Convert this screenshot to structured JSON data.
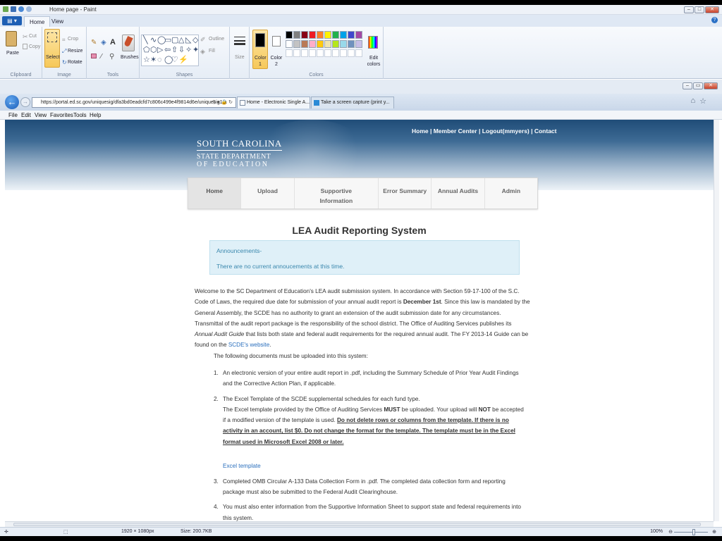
{
  "paint": {
    "title": "Home page - Paint",
    "tabs": {
      "home": "Home",
      "view": "View"
    },
    "clipboard": {
      "paste": "Paste",
      "cut": "Cut",
      "copy": "Copy",
      "label": "Clipboard"
    },
    "image": {
      "select": "Select",
      "crop": "Crop",
      "resize": "Resize",
      "rotate": "Rotate",
      "label": "Image"
    },
    "tools": {
      "label": "Tools",
      "brushes": "Brushes"
    },
    "shapes": {
      "outline": "Outline",
      "fill": "Fill",
      "label": "Shapes",
      "glyphs": [
        "╲",
        "∿",
        "◯",
        "▭",
        "▢",
        "△",
        "◺",
        "◇",
        "⬠",
        "⬡",
        "▷",
        "⇦",
        "⇧",
        "⇩",
        "✧",
        "✦",
        "☆",
        "✶",
        "◌",
        "◯",
        "♡",
        "⚡"
      ]
    },
    "size": "Size",
    "colors": {
      "color1": "Color 1",
      "color2": "Color 2",
      "edit": "Edit colors",
      "label": "Colors",
      "palette_row1": [
        "#000000",
        "#7f7f7f",
        "#880015",
        "#ed1c24",
        "#ff7f27",
        "#fff200",
        "#22b14c",
        "#00a2e8",
        "#3f48cc",
        "#a349a4"
      ],
      "palette_row2": [
        "#ffffff",
        "#c3c3c3",
        "#b97a57",
        "#ffaec9",
        "#ffc90e",
        "#efe4b0",
        "#b5e61d",
        "#99d9ea",
        "#7092be",
        "#c8bfe7"
      ]
    },
    "status": {
      "dimensions": "1920 × 1080px",
      "size": "Size: 200.7KB",
      "zoom": "100%"
    }
  },
  "browser": {
    "url": "https://portal.ed.sc.gov/uniquesig/dfa3bd0eadcfd7c806c499e4f9814d6e/uniquesig1/a",
    "tabs": [
      "Home - Electronic Single A...",
      "Take a screen capture (print y..."
    ],
    "menu": [
      "File",
      "Edit",
      "View",
      "Favorites",
      "Tools",
      "Help"
    ]
  },
  "site": {
    "logo": {
      "line1": "SOUTH CAROLINA",
      "line2": "STATE DEPARTMENT",
      "line3": "OF EDUCATION"
    },
    "toplinks": "Home | Member Center | Logout(mmyers) | Contact",
    "nav": [
      {
        "label": "Home"
      },
      {
        "label": "Upload"
      },
      {
        "label": "Supportive Information"
      },
      {
        "label": "Error Summary"
      },
      {
        "label": "Annual Audits"
      },
      {
        "label": "Admin"
      }
    ],
    "heading": "LEA Audit Reporting System",
    "announcements": {
      "title": "Announcements-",
      "body": "There are no current annoucements at this time."
    },
    "intro": {
      "p1": "Welcome to the SC Department of Education's LEA audit submission system. In accordance with Section 59-17-100 of the S.C. Code of Laws, the required due date for submission of your annual audit report is ",
      "due": "December 1st",
      "p2": ". Since this law is mandated by the General Assembly, the SCDE has no authority to grant an extension of the audit submission date for any circumstances. Transmittal of the audit report package is the responsibility of the school district. The Office of Auditing Services publishes its ",
      "guide": "Annual Audit Guide",
      "p3": " that lists both state and federal audit requirements for the required annual audit. The FY 2013-14 Guide can be found on the ",
      "link": "SCDE's website",
      "p4": "."
    },
    "docs": {
      "lead": "The following documents must be uploaded into this system:",
      "item1": "An electronic version of your entire audit report in .pdf, including the Summary Schedule of Prior Year Audit Findings and the Corrective Action Plan, if applicable.",
      "item2a": "The Excel Template of the SCDE supplemental schedules for each fund type.",
      "item2b": "The Excel template provided by the Office of Auditing Services ",
      "must": "MUST",
      "item2c": " be uploaded. Your upload will ",
      "not": "NOT",
      "item2d": " be accepted if a modified version of the template is used. ",
      "item2u": "Do not delete rows or columns from the template. If there is no activity in an account, list $0. Do not change the format for the template. The template must be in the Excel format used in Microsoft Excel 2008 or later.",
      "excel_link": "Excel template",
      "item3": "Completed OMB Circular A-133 Data Collection Form in .pdf. The completed data collection form and reporting package must also be submitted to the Federal Audit Clearinghouse.",
      "item4": "You must also enter information from the Supportive Information Sheet to support state and federal requirements into this system."
    }
  }
}
